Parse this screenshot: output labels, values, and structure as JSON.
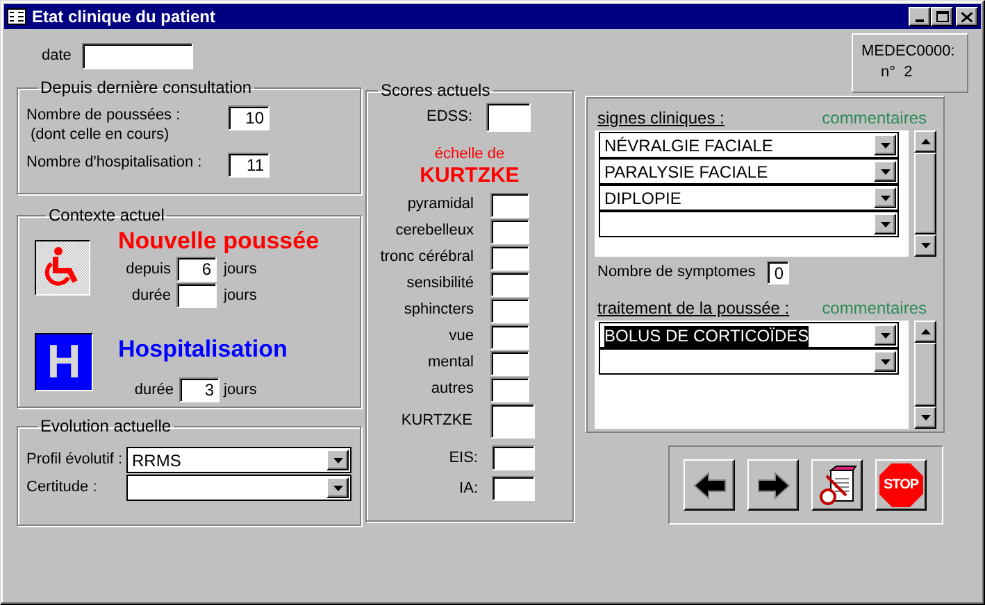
{
  "window": {
    "title": "Etat clinique du patient"
  },
  "date": {
    "label": "date"
  },
  "record": {
    "line_1": "MEDEC0000:",
    "line_2": "n°  2"
  },
  "depuis": {
    "title": "Depuis dernière consultation",
    "fields": [
      {
        "label": "Nombre de poussées :",
        "sublabel": "(dont celle en cours)",
        "value": "10"
      },
      {
        "label": "Nombre d'hospitalisation :",
        "value": "11"
      }
    ]
  },
  "contexte": {
    "title": "Contexte actuel",
    "nouvelle_poussee": {
      "heading": "Nouvelle poussée",
      "rows": [
        {
          "label": "depuis",
          "value": "6",
          "unit": "jours"
        },
        {
          "label": "durée",
          "unit": "jours"
        }
      ]
    },
    "hospitalisation": {
      "heading": "Hospitalisation",
      "sign": "H",
      "rows": [
        {
          "label": "durée",
          "value": "3",
          "unit": "jours"
        }
      ]
    }
  },
  "evolution": {
    "title": "Evolution actuelle",
    "fields": [
      {
        "label": "Profil évolutif :",
        "value": "RRMS"
      },
      {
        "label": "Certitude :"
      }
    ]
  },
  "scores": {
    "title": "Scores actuels",
    "edss_label": "EDSS:",
    "scale_caption": "échelle de",
    "scale_name": "KURTZKE",
    "items": [
      {
        "label": "pyramidal"
      },
      {
        "label": "cerebelleux"
      },
      {
        "label": "tronc cérébral"
      },
      {
        "label": "sensibilité"
      },
      {
        "label": "sphincters"
      },
      {
        "label": "vue"
      },
      {
        "label": "mental"
      },
      {
        "label": "autres"
      }
    ],
    "total_label": "KURTZKE",
    "eis_label": "EIS:",
    "ia_label": "IA:"
  },
  "signes": {
    "title": "signes cliniques :",
    "comment_link": "commentaires",
    "items": [
      {
        "kind": "filled",
        "value": "NÉVRALGIE FACIALE",
        "selected": false
      },
      {
        "kind": "filled",
        "value": "PARALYSIE FACIALE",
        "selected": false
      },
      {
        "kind": "filled",
        "value": "DIPLOPIE",
        "selected": false
      },
      {
        "kind": "empty",
        "selected": false
      }
    ]
  },
  "symptom_count": {
    "label": "Nombre de symptomes",
    "value": "0"
  },
  "traitement": {
    "title": "traitement de la poussée :",
    "comment_link": "commentaires",
    "items": [
      {
        "kind": "filled",
        "value": "BOLUS DE CORTICOÏDES",
        "selected": true
      },
      {
        "kind": "empty",
        "selected": false
      }
    ]
  },
  "nav": {
    "buttons": [
      {
        "kind": "back"
      },
      {
        "kind": "forward"
      },
      {
        "kind": "notepad"
      },
      {
        "kind": "stop",
        "label": "STOP"
      }
    ]
  }
}
